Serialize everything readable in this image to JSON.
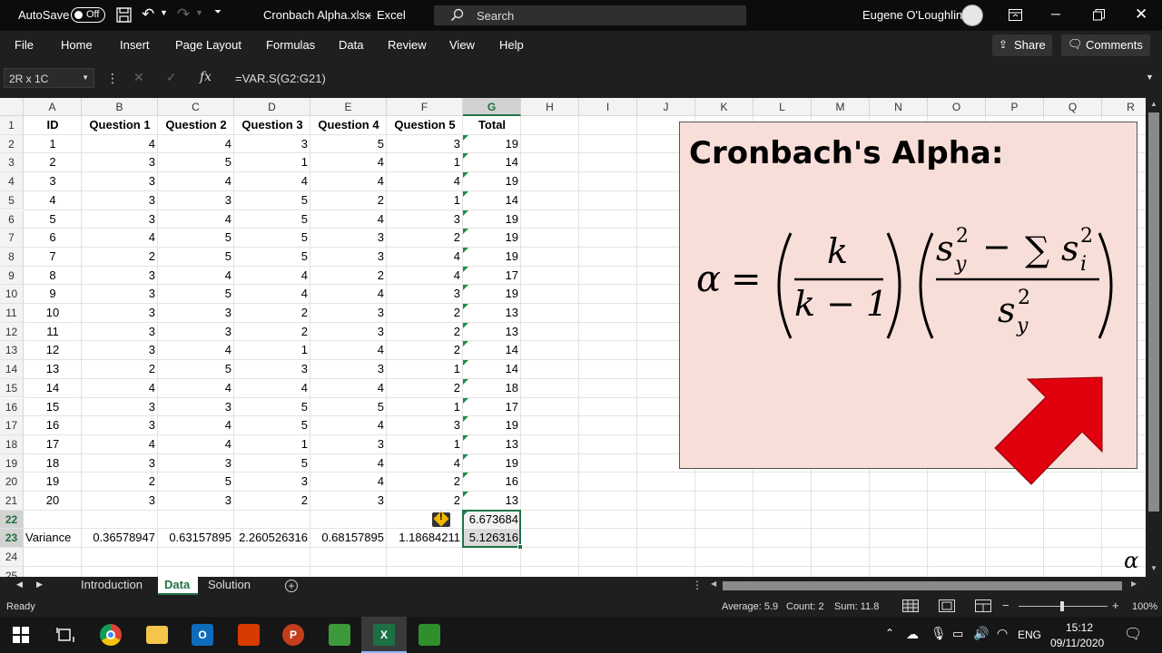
{
  "titlebar": {
    "autosave_label": "AutoSave",
    "autosave_state": "Off",
    "filename": "Cronbach Alpha.xlsx",
    "sep": "-",
    "app": "Excel",
    "search_placeholder": "Search",
    "user": "Eugene O'Loughlin"
  },
  "ribbon": {
    "tabs": [
      "File",
      "Home",
      "Insert",
      "Page Layout",
      "Formulas",
      "Data",
      "Review",
      "View",
      "Help"
    ],
    "share": "Share",
    "comments": "Comments"
  },
  "formula_bar": {
    "name_box": "2R x 1C",
    "fx": "fx",
    "formula": "=VAR.S(G2:G21)"
  },
  "columns": [
    "A",
    "B",
    "C",
    "D",
    "E",
    "F",
    "G",
    "H",
    "I",
    "J",
    "K",
    "L",
    "M",
    "N",
    "O",
    "P",
    "Q",
    "R"
  ],
  "rows_visible": [
    "1",
    "2",
    "3",
    "4",
    "5",
    "6",
    "7",
    "8",
    "9",
    "10",
    "11",
    "12",
    "13",
    "14",
    "15",
    "16",
    "17",
    "18",
    "19",
    "20",
    "21",
    "22",
    "23",
    "24",
    "25"
  ],
  "table": {
    "headers": [
      "ID",
      "Question 1",
      "Question 2",
      "Question 3",
      "Question 4",
      "Question 5",
      "Total"
    ],
    "rows": [
      [
        "1",
        "4",
        "4",
        "3",
        "5",
        "3",
        "19"
      ],
      [
        "2",
        "3",
        "5",
        "1",
        "4",
        "1",
        "14"
      ],
      [
        "3",
        "3",
        "4",
        "4",
        "4",
        "4",
        "19"
      ],
      [
        "4",
        "3",
        "3",
        "5",
        "2",
        "1",
        "14"
      ],
      [
        "5",
        "3",
        "4",
        "5",
        "4",
        "3",
        "19"
      ],
      [
        "6",
        "4",
        "5",
        "5",
        "3",
        "2",
        "19"
      ],
      [
        "7",
        "2",
        "5",
        "5",
        "3",
        "4",
        "19"
      ],
      [
        "8",
        "3",
        "4",
        "4",
        "2",
        "4",
        "17"
      ],
      [
        "9",
        "3",
        "5",
        "4",
        "4",
        "3",
        "19"
      ],
      [
        "10",
        "3",
        "3",
        "2",
        "3",
        "2",
        "13"
      ],
      [
        "11",
        "3",
        "3",
        "2",
        "3",
        "2",
        "13"
      ],
      [
        "12",
        "3",
        "4",
        "1",
        "4",
        "2",
        "14"
      ],
      [
        "13",
        "2",
        "5",
        "3",
        "3",
        "1",
        "14"
      ],
      [
        "14",
        "4",
        "4",
        "4",
        "4",
        "2",
        "18"
      ],
      [
        "15",
        "3",
        "3",
        "5",
        "5",
        "1",
        "17"
      ],
      [
        "16",
        "3",
        "4",
        "5",
        "4",
        "3",
        "19"
      ],
      [
        "17",
        "4",
        "4",
        "1",
        "3",
        "1",
        "13"
      ],
      [
        "18",
        "3",
        "3",
        "5",
        "4",
        "4",
        "19"
      ],
      [
        "19",
        "2",
        "5",
        "3",
        "4",
        "2",
        "16"
      ],
      [
        "20",
        "3",
        "3",
        "2",
        "3",
        "2",
        "13"
      ]
    ],
    "row22_g": "6.673684",
    "variance_label": "Variance",
    "variance_values": [
      "0.36578947",
      "0.63157895",
      "2.260526316",
      "0.68157895",
      "1.18684211",
      "5.126316"
    ]
  },
  "overlay": {
    "title": "Cronbach's Alpha:",
    "formula": {
      "alpha": "α",
      "eq": "=",
      "k": "k",
      "k_minus_1": "k − 1",
      "sy": "s",
      "sy_sub": "y",
      "sup2": "2",
      "minus": "−",
      "sum": "∑",
      "si": "s",
      "si_sub": "i"
    },
    "arrow_color": "#e0000e",
    "background_color": "#f8ded9"
  },
  "corner_alpha": "α",
  "sheets": {
    "tabs": [
      "Introduction",
      "Data",
      "Solution"
    ],
    "active": "Data"
  },
  "status": {
    "ready": "Ready",
    "average": "Average: 5.9",
    "count": "Count: 2",
    "sum": "Sum: 11.8",
    "zoom": "100%"
  },
  "taskbar": {
    "lang": "ENG",
    "time": "15:12",
    "date": "09/11/2020"
  },
  "colors": {
    "excel_green": "#217346",
    "ribbon_bg": "#1f1f1f",
    "titlebar_bg": "#0c0c0c"
  }
}
